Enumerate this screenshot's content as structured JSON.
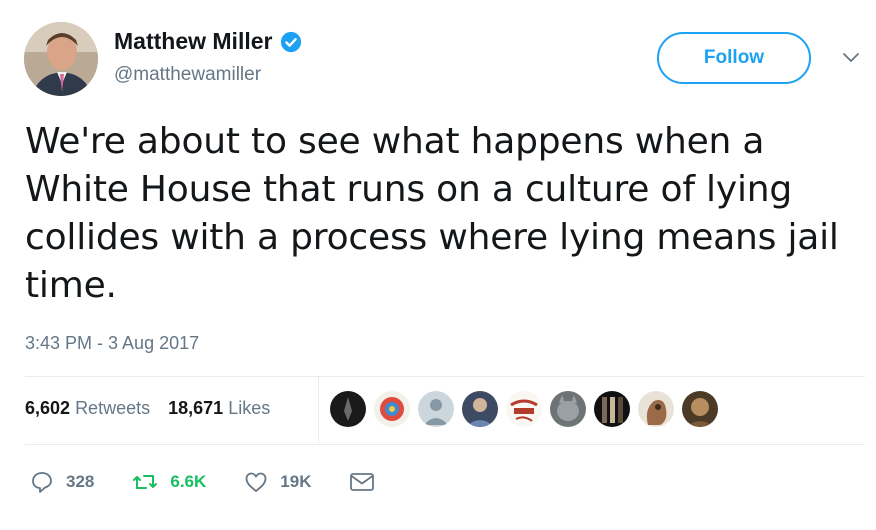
{
  "author": {
    "name": "Matthew Miller",
    "handle": "@matthewamiller",
    "verified_icon": "verified-badge-icon",
    "avatar_icon": "profile-photo"
  },
  "follow_button": {
    "label": "Follow"
  },
  "menu_icon": "chevron-down-icon",
  "tweet": {
    "text": "We're about to see what happens when a White House that runs on a culture of lying collides with a process where lying means jail time.",
    "timestamp": "3:43 PM - 3 Aug 2017"
  },
  "stats": {
    "retweets_count": "6,602",
    "retweets_label": "Retweets",
    "likes_count": "18,671",
    "likes_label": "Likes"
  },
  "liker_avatars": [
    {
      "name": "liker-avatar-1"
    },
    {
      "name": "liker-avatar-2"
    },
    {
      "name": "liker-avatar-3"
    },
    {
      "name": "liker-avatar-4"
    },
    {
      "name": "liker-avatar-5"
    },
    {
      "name": "liker-avatar-6"
    },
    {
      "name": "liker-avatar-7"
    },
    {
      "name": "liker-avatar-8"
    },
    {
      "name": "liker-avatar-9"
    }
  ],
  "actions": {
    "reply_count": "328",
    "retweet_count": "6.6K",
    "like_count": "19K"
  },
  "colors": {
    "accent": "#1da1f2",
    "retweet_green": "#17bf63",
    "muted": "#657786",
    "text": "#14171a"
  }
}
